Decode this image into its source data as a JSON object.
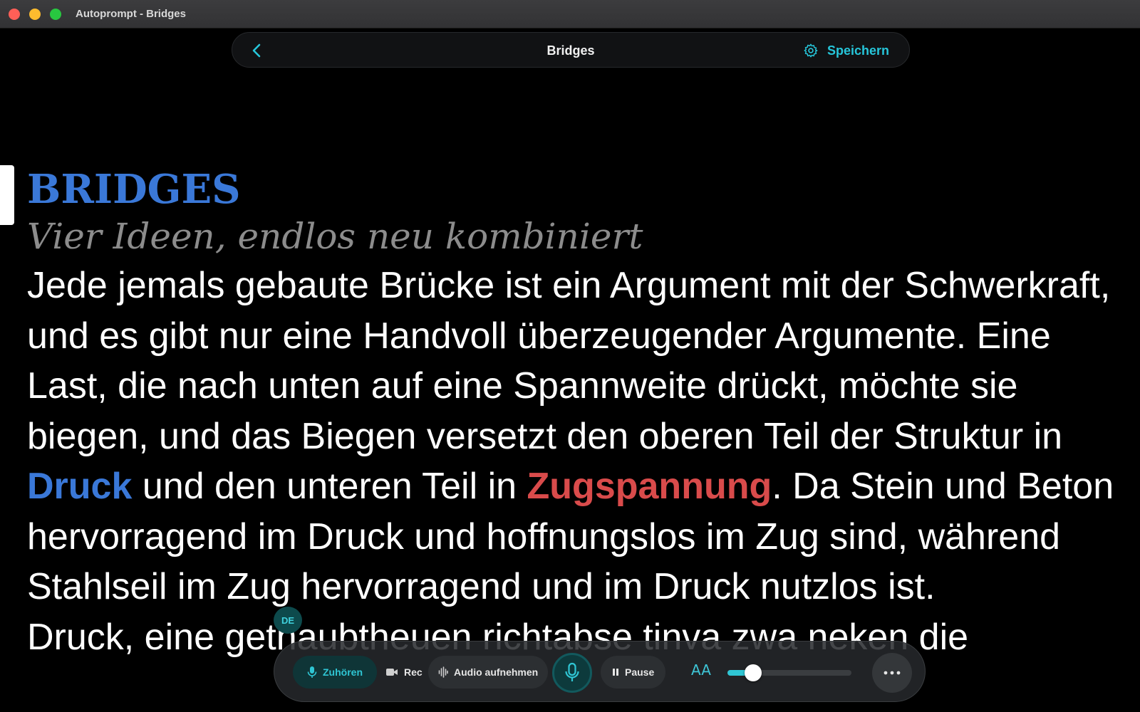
{
  "window": {
    "title": "Autoprompt - Bridges"
  },
  "topnav": {
    "title": "Bridges",
    "save_label": "Speichern",
    "accent_color": "#26c6da"
  },
  "prompt": {
    "heading": "BRIDGES",
    "subheading": "Vier Ideen, endlos neu kombiniert",
    "p1_before": "Jede jemals gebaute Brücke ist ein Argument mit der Schwerkraft, und es gibt nur eine Handvoll überzeugender Argumente. Eine Last, die nach unten auf eine Spannweite drückt, möchte sie biegen, und das Biegen versetzt den oberen Teil der Struktur in ",
    "kw_compression": "Druck",
    "p1_middle": " und den unteren Teil in ",
    "kw_tension": "Zugspannung",
    "p1_after": ". Da Stein und Beton hervorragend im Druck und hoffnungslos im Zug sind, während Stahlseil im Zug hervorragend und im Druck nutzlos ist.",
    "p2": "Druck, eine gethaubtheuen richtabse tinva zwa neken die",
    "colors": {
      "heading": "#3a78d8",
      "compression": "#3a78d8",
      "tension": "#d94b4b",
      "subheading": "#8c8c8c"
    }
  },
  "language_badge": "DE",
  "controls": {
    "listen_label": "Zuhören",
    "rec_label": "Rec",
    "audio_label": "Audio aufnehmen",
    "pause_label": "Pause",
    "font_size_icon_label": "AA",
    "font_size_level": 0.14,
    "icons": [
      "mic-icon",
      "video-camera-icon",
      "waveform-icon",
      "pause-icon",
      "more-icon",
      "gear-icon",
      "chevron-left-icon"
    ]
  }
}
